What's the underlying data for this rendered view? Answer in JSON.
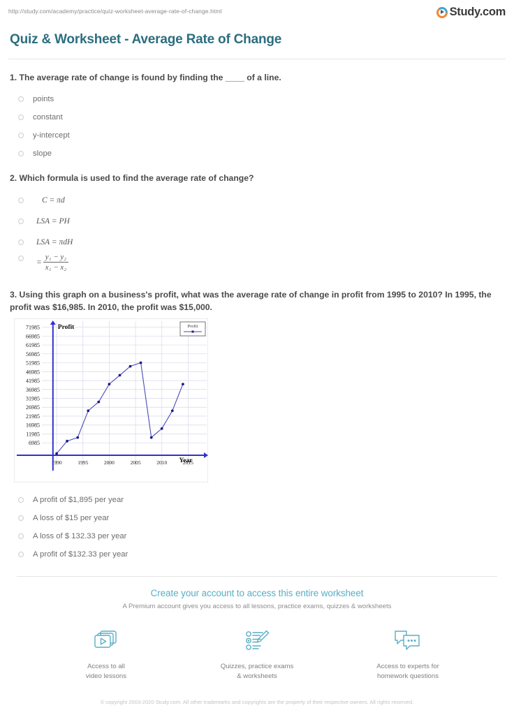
{
  "header": {
    "url": "http://study.com/academy/practice/quiz-worksheet-average-rate-of-change.html",
    "logo_text": "Study.com",
    "logo_icon": "play-circle-icon",
    "page_title": "Quiz & Worksheet - Average Rate of Change",
    "accent_color": "#2c6e80"
  },
  "questions": [
    {
      "number": "1.",
      "text": "1. The average rate of change is found by finding the ____ of a line.",
      "options": [
        {
          "label": "points"
        },
        {
          "label": "constant"
        },
        {
          "label": "y-intercept"
        },
        {
          "label": "slope"
        }
      ]
    },
    {
      "number": "2.",
      "text": "2. Which formula is used to find the average rate of change?",
      "options": [
        {
          "label": "C = πd",
          "type": "math"
        },
        {
          "label": "LSA = PH",
          "type": "math"
        },
        {
          "label": "LSA =  πdH",
          "type": "math"
        },
        {
          "type": "fraction",
          "equals": "=",
          "numerator": "y₁ − y₂",
          "denominator": "x₁ − x₂"
        }
      ]
    },
    {
      "number": "3.",
      "text": "3. Using this graph on a business's profit, what was the average rate of change in profit from 1995 to 2010? In 1995, the profit was $16,985. In 2010, the profit was $15,000.",
      "options": [
        {
          "label": "A profit of $1,895 per year"
        },
        {
          "label": "A loss of $15 per year"
        },
        {
          "label": "A loss of $ 132.33 per year"
        },
        {
          "label": "A profit of $132.33 per year"
        }
      ]
    }
  ],
  "chart_data": {
    "type": "line",
    "title": "Profit",
    "xlabel": "Year",
    "ylabel": "Profit",
    "legend": [
      "Profit"
    ],
    "legend_position": "top-right",
    "grid": true,
    "series_color": "#3b3bb0",
    "axis_color": "#3030d0",
    "x": [
      1990,
      1992,
      1994,
      1996,
      1998,
      2000,
      2002,
      2004,
      2006,
      2008,
      2010,
      2012,
      2014
    ],
    "values": [
      985,
      7985,
      9985,
      24985,
      29985,
      39985,
      44985,
      49985,
      51985,
      9985,
      14985,
      24985,
      39985
    ],
    "xticks": [
      "1990",
      "1995",
      "2000",
      "2005",
      "2010",
      "2015"
    ],
    "yticks": [
      "6985",
      "11985",
      "16985",
      "21985",
      "26985",
      "31985",
      "36985",
      "41985",
      "46985",
      "51985",
      "56985",
      "61985",
      "66985",
      "71985"
    ],
    "xlim": [
      1988,
      2018
    ],
    "ylim": [
      0,
      73000
    ]
  },
  "footer": {
    "cta_title": "Create your account to access this entire worksheet",
    "cta_subtitle": "A Premium account gives you access to all lessons, practice exams, quizzes & worksheets",
    "cta_color": "#59aec4",
    "features": [
      {
        "icon": "video-lessons-icon",
        "line1": "Access to all",
        "line2": "video lessons"
      },
      {
        "icon": "quiz-pencil-icon",
        "line1": "Quizzes, practice exams",
        "line2": "& worksheets"
      },
      {
        "icon": "chat-bubbles-icon",
        "line1": "Access to experts for",
        "line2": "homework questions"
      }
    ],
    "copyright": "© copyright 2003-2020 Study.com. All other trademarks and copyrights are the property of their respective owners. All rights reserved."
  }
}
